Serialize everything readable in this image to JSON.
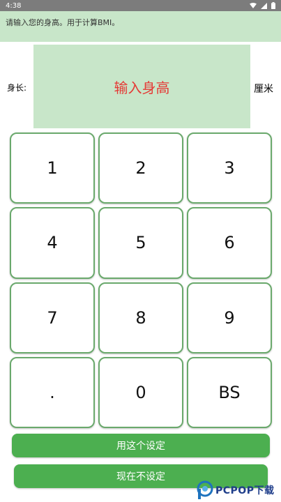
{
  "status_bar": {
    "time": "4:38"
  },
  "instruction": "请输入您的身高。用于计算BMI。",
  "height": {
    "label": "身长:",
    "placeholder": "输入身高",
    "unit": "厘米"
  },
  "keypad": {
    "keys": [
      "1",
      "2",
      "3",
      "4",
      "5",
      "6",
      "7",
      "8",
      "9",
      ".",
      "0",
      "BS"
    ]
  },
  "buttons": {
    "apply": "用这个设定",
    "skip": "现在不设定"
  },
  "watermark": {
    "text": "PCPOP下载"
  },
  "colors": {
    "accent": "#4caf50",
    "panel": "#c8e6c9",
    "placeholder_text": "#e53935"
  }
}
